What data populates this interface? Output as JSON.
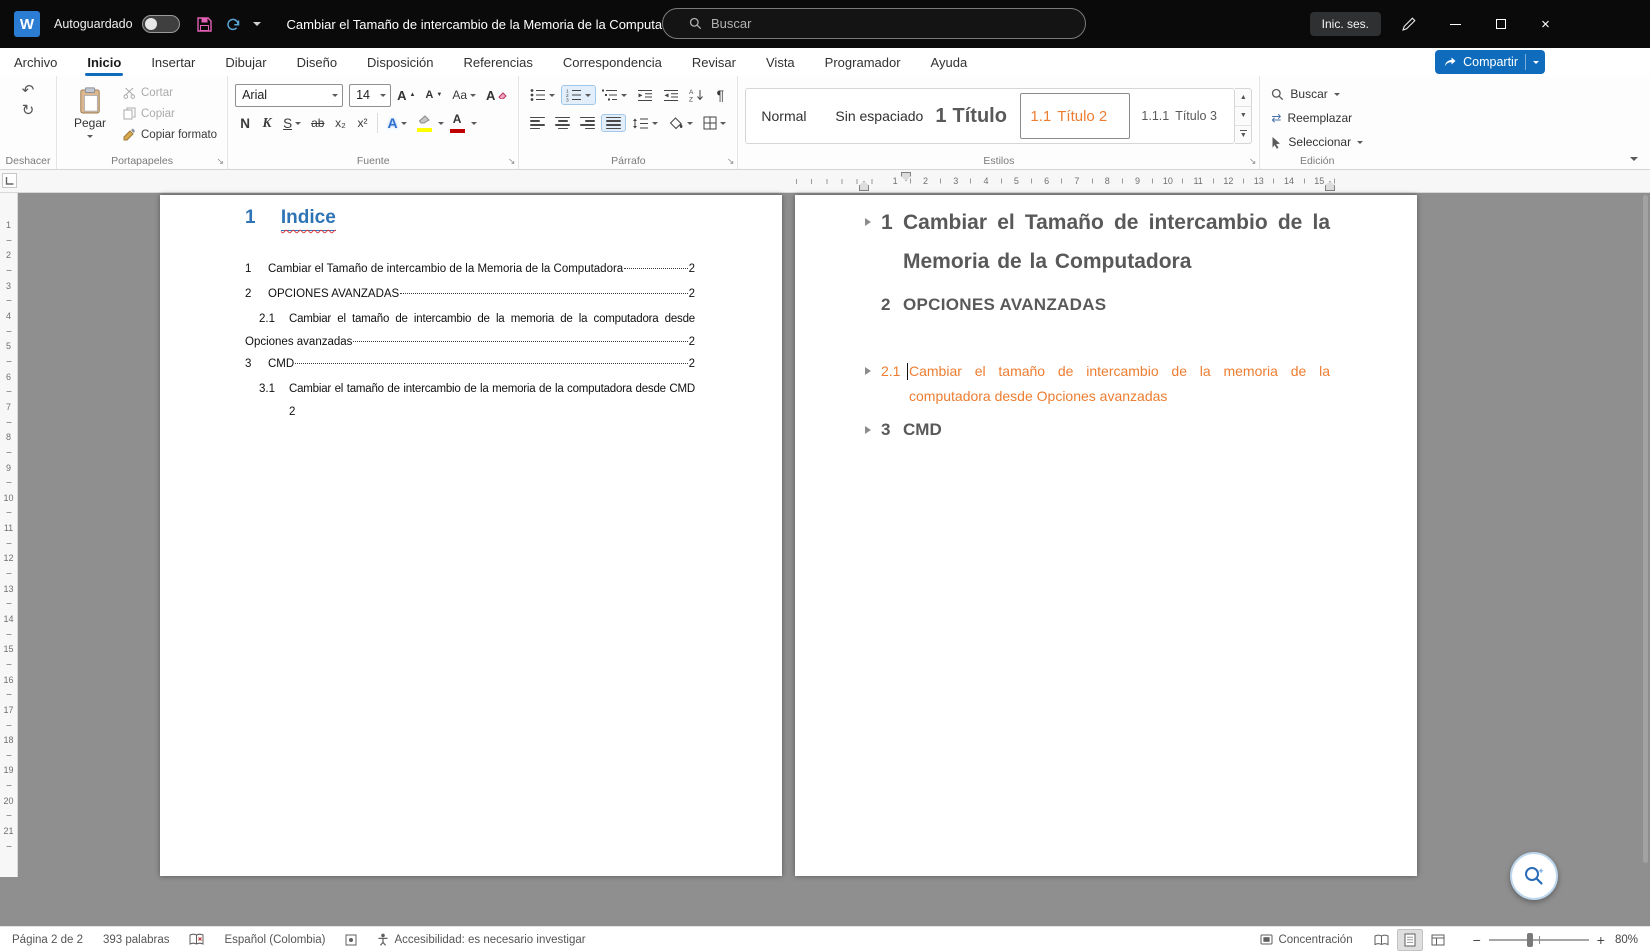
{
  "titlebar": {
    "autosave_label": "Autoguardado",
    "doc_title": "Cambiar el Tamaño de intercambio de la Memoria de la Computadora",
    "search_placeholder": "Buscar",
    "signin_label": "Inic. ses."
  },
  "menubar": {
    "tabs": [
      "Archivo",
      "Inicio",
      "Insertar",
      "Dibujar",
      "Diseño",
      "Disposición",
      "Referencias",
      "Correspondencia",
      "Revisar",
      "Vista",
      "Programador",
      "Ayuda"
    ],
    "share_label": "Compartir"
  },
  "ribbon": {
    "undo_group_label": "Deshacer",
    "clipboard": {
      "group_label": "Portapapeles",
      "paste_label": "Pegar",
      "cut_label": "Cortar",
      "copy_label": "Copiar",
      "format_painter_label": "Copiar formato"
    },
    "font": {
      "group_label": "Fuente",
      "family": "Arial",
      "size": "14"
    },
    "paragraph": {
      "group_label": "Párrafo"
    },
    "styles": {
      "group_label": "Estilos",
      "items": [
        {
          "prefix": "",
          "label": "Normal"
        },
        {
          "prefix": "",
          "label": "Sin espaciado"
        },
        {
          "prefix": "1",
          "label": "Título"
        },
        {
          "prefix": "1.1",
          "label": "Título 2"
        },
        {
          "prefix": "1.1.1",
          "label": "Título 3"
        }
      ]
    },
    "editing": {
      "group_label": "Edición",
      "find_label": "Buscar",
      "replace_label": "Reemplazar",
      "select_label": "Seleccionar"
    }
  },
  "ruler": {
    "horizontal_numbers": [
      "1",
      "2",
      "3",
      "4",
      "5",
      "6",
      "7",
      "8",
      "9",
      "10",
      "11",
      "12",
      "13",
      "14",
      "15"
    ],
    "vertical_numbers": [
      "1",
      "2",
      "3",
      "4",
      "5",
      "6",
      "7",
      "8",
      "9",
      "10",
      "11",
      "12",
      "13",
      "14",
      "15",
      "16",
      "17",
      "18",
      "19",
      "20",
      "21"
    ]
  },
  "document": {
    "toc_page": {
      "heading_number": "1",
      "heading_text": "Indice",
      "entries": [
        {
          "num": "1",
          "text": "Cambiar el Tamaño de intercambio de la Memoria de la Computadora",
          "page": "2"
        },
        {
          "num": "2",
          "text": "OPCIONES AVANZADAS",
          "page": "2"
        },
        {
          "num": "2.1",
          "text_line1": "Cambiar el tamaño de intercambio de la memoria de la computadora desde",
          "text_line2": "Opciones avanzadas",
          "page": "2"
        },
        {
          "num": "3",
          "text": "CMD",
          "page": "2"
        },
        {
          "num": "3.1",
          "text_line1": "Cambiar el tamaño de intercambio de la memoria de la computadora desde CMD",
          "page": "2"
        }
      ]
    },
    "content_page": {
      "heading1": {
        "num": "1",
        "text": "Cambiar el Tamaño de intercambio de la Memoria de la Computadora"
      },
      "heading2": {
        "num": "2",
        "text": "OPCIONES AVANZADAS"
      },
      "heading21": {
        "num": "2.1",
        "text": "Cambiar el tamaño de intercambio de la memoria de la computadora desde Opciones avanzadas"
      },
      "heading3": {
        "num": "3",
        "text": "CMD"
      }
    }
  },
  "statusbar": {
    "page_indicator": "Página 2 de 2",
    "word_count": "393 palabras",
    "language": "Español (Colombia)",
    "accessibility": "Accesibilidad: es necesario investigar",
    "focus_label": "Concentración",
    "zoom_level": "80%"
  },
  "colors": {
    "accent_blue": "#0f6cbd",
    "heading_gray": "#595959",
    "heading_orange": "#ED7D31",
    "toc_heading_blue": "#2E74B5",
    "titlebar_black": "#0a0a0a"
  }
}
